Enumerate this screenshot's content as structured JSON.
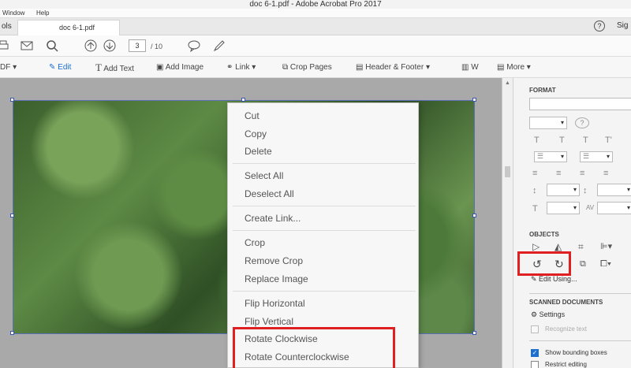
{
  "window": {
    "title": "doc 6-1.pdf - Adobe Acrobat Pro 2017"
  },
  "menubar": {
    "items": [
      "Window",
      "Help"
    ]
  },
  "tabs": {
    "tools_label": "ols",
    "doc_tab": "doc 6-1.pdf",
    "help": "?",
    "sign": "Sig"
  },
  "toolbar": {
    "page_current": "3",
    "page_total": "/ 10"
  },
  "editbar": {
    "left_label": "DF",
    "edit": "Edit",
    "add_text": "Add Text",
    "add_image": "Add Image",
    "link": "Link",
    "crop_pages": "Crop Pages",
    "header_footer": "Header & Footer",
    "w": "W",
    "more": "More"
  },
  "context_menu": {
    "cut": "Cut",
    "copy": "Copy",
    "delete": "Delete",
    "select_all": "Select All",
    "deselect_all": "Deselect All",
    "create_link": "Create Link...",
    "crop": "Crop",
    "remove_crop": "Remove Crop",
    "replace_image": "Replace Image",
    "flip_horizontal": "Flip Horizontal",
    "flip_vertical": "Flip Vertical",
    "rotate_cw": "Rotate Clockwise",
    "rotate_ccw": "Rotate Counterclockwise"
  },
  "format_panel": {
    "format_header": "FORMAT",
    "objects_header": "OBJECTS",
    "edit_using": "Edit Using...",
    "scanned_header": "SCANNED DOCUMENTS",
    "settings": "Settings",
    "recognize_text": "Recognize text",
    "show_bounding": "Show bounding boxes",
    "restrict_editing": "Restrict editing"
  },
  "colors": {
    "accent": "#1a6fd1",
    "highlight": "#e02020"
  }
}
